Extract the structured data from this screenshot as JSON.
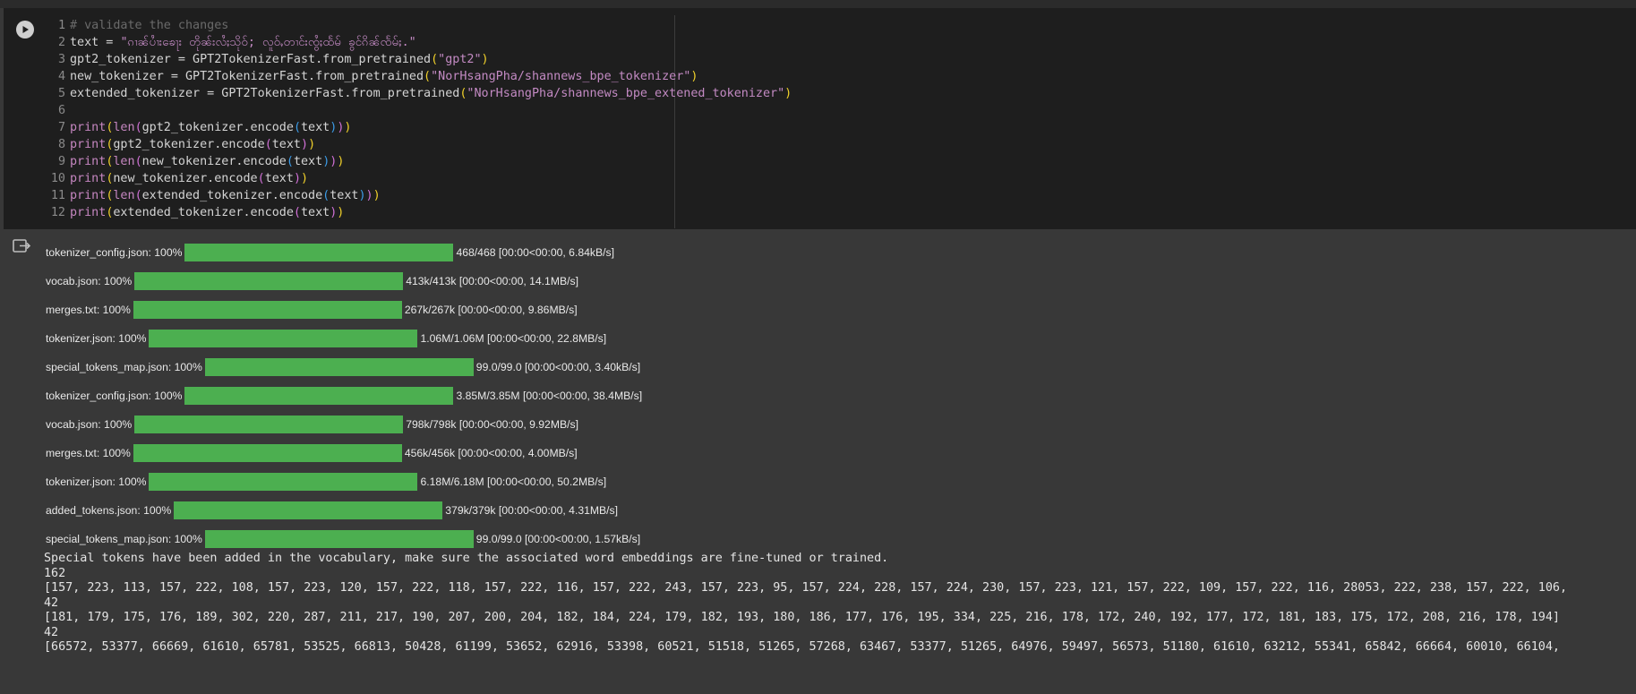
{
  "code_cell": {
    "lines": [
      {
        "n": "1",
        "tokens": [
          [
            "c-com",
            "# validate the changes"
          ]
        ]
      },
      {
        "n": "2",
        "tokens": [
          [
            "c-kw",
            "text = "
          ],
          [
            "c-str",
            "\"ၵၢၼ်ပၢႆးၶေႃး တိုၼ်းလႆႈသိုဝ်; လူဝ်ႇတၢင်းၸွႆႈထႅမ် ၶွင်ၵိၼ်ၸႅမ်ႈ.\""
          ]
        ]
      },
      {
        "n": "3",
        "tokens": [
          [
            "c-kw",
            "gpt2_tokenizer = GPT2TokenizerFast.from_pretrained"
          ],
          [
            "c-b1",
            "("
          ],
          [
            "c-str",
            "\"gpt2\""
          ],
          [
            "c-b1",
            ")"
          ]
        ]
      },
      {
        "n": "4",
        "tokens": [
          [
            "c-kw",
            "new_tokenizer = GPT2TokenizerFast.from_pretrained"
          ],
          [
            "c-b1",
            "("
          ],
          [
            "c-str",
            "\"NorHsangPha/shannews_bpe_tokenizer\""
          ],
          [
            "c-b1",
            ")"
          ]
        ]
      },
      {
        "n": "5",
        "tokens": [
          [
            "c-kw",
            "extended_tokenizer = GPT2TokenizerFast.from_pretrained"
          ],
          [
            "c-b1",
            "("
          ],
          [
            "c-str",
            "\"NorHsangPha/shannews_bpe_extened_tokenizer\""
          ],
          [
            "c-b1",
            ")"
          ]
        ]
      },
      {
        "n": "6",
        "tokens": []
      },
      {
        "n": "7",
        "tokens": [
          [
            "c-fn",
            "print"
          ],
          [
            "c-b1",
            "("
          ],
          [
            "c-fn",
            "len"
          ],
          [
            "c-b2",
            "("
          ],
          [
            "c-kw",
            "gpt2_tokenizer.encode"
          ],
          [
            "c-b3",
            "("
          ],
          [
            "c-kw",
            "text"
          ],
          [
            "c-b3",
            ")"
          ],
          [
            "c-b2",
            ")"
          ],
          [
            "c-b1",
            ")"
          ]
        ]
      },
      {
        "n": "8",
        "tokens": [
          [
            "c-fn",
            "print"
          ],
          [
            "c-b1",
            "("
          ],
          [
            "c-kw",
            "gpt2_tokenizer.encode"
          ],
          [
            "c-b2",
            "("
          ],
          [
            "c-kw",
            "text"
          ],
          [
            "c-b2",
            ")"
          ],
          [
            "c-b1",
            ")"
          ]
        ]
      },
      {
        "n": "9",
        "tokens": [
          [
            "c-fn",
            "print"
          ],
          [
            "c-b1",
            "("
          ],
          [
            "c-fn",
            "len"
          ],
          [
            "c-b2",
            "("
          ],
          [
            "c-kw",
            "new_tokenizer.encode"
          ],
          [
            "c-b3",
            "("
          ],
          [
            "c-kw",
            "text"
          ],
          [
            "c-b3",
            ")"
          ],
          [
            "c-b2",
            ")"
          ],
          [
            "c-b1",
            ")"
          ]
        ]
      },
      {
        "n": "10",
        "tokens": [
          [
            "c-fn",
            "print"
          ],
          [
            "c-b1",
            "("
          ],
          [
            "c-kw",
            "new_tokenizer.encode"
          ],
          [
            "c-b2",
            "("
          ],
          [
            "c-kw",
            "text"
          ],
          [
            "c-b2",
            ")"
          ],
          [
            "c-b1",
            ")"
          ]
        ]
      },
      {
        "n": "11",
        "tokens": [
          [
            "c-fn",
            "print"
          ],
          [
            "c-b1",
            "("
          ],
          [
            "c-fn",
            "len"
          ],
          [
            "c-b2",
            "("
          ],
          [
            "c-kw",
            "extended_tokenizer.encode"
          ],
          [
            "c-b3",
            "("
          ],
          [
            "c-kw",
            "text"
          ],
          [
            "c-b3",
            ")"
          ],
          [
            "c-b2",
            ")"
          ],
          [
            "c-b1",
            ")"
          ]
        ]
      },
      {
        "n": "12",
        "tokens": [
          [
            "c-fn",
            "print"
          ],
          [
            "c-b1",
            "("
          ],
          [
            "c-kw",
            "extended_tokenizer.encode"
          ],
          [
            "c-b2",
            "("
          ],
          [
            "c-kw",
            "text"
          ],
          [
            "c-b2",
            ")"
          ],
          [
            "c-b1",
            ")"
          ]
        ]
      }
    ]
  },
  "output": {
    "progress": [
      {
        "label": "tokenizer_config.json: 100%",
        "fill": 1.0,
        "stats": "468/468 [00:00<00:00, 6.84kB/s]"
      },
      {
        "label": "vocab.json: 100%",
        "fill": 1.0,
        "stats": "413k/413k [00:00<00:00, 14.1MB/s]"
      },
      {
        "label": "merges.txt: 100%",
        "fill": 1.0,
        "stats": "267k/267k [00:00<00:00, 9.86MB/s]"
      },
      {
        "label": "tokenizer.json: 100%",
        "fill": 1.0,
        "stats": "1.06M/1.06M [00:00<00:00, 22.8MB/s]"
      },
      {
        "label": "special_tokens_map.json: 100%",
        "fill": 1.0,
        "stats": "99.0/99.0 [00:00<00:00, 3.40kB/s]"
      },
      {
        "label": "tokenizer_config.json: 100%",
        "fill": 1.0,
        "stats": "3.85M/3.85M [00:00<00:00, 38.4MB/s]"
      },
      {
        "label": "vocab.json: 100%",
        "fill": 1.0,
        "stats": "798k/798k [00:00<00:00, 9.92MB/s]"
      },
      {
        "label": "merges.txt: 100%",
        "fill": 1.0,
        "stats": "456k/456k [00:00<00:00, 4.00MB/s]"
      },
      {
        "label": "tokenizer.json: 100%",
        "fill": 1.0,
        "stats": "6.18M/6.18M [00:00<00:00, 50.2MB/s]"
      },
      {
        "label": "added_tokens.json: 100%",
        "fill": 1.0,
        "stats": "379k/379k [00:00<00:00, 4.31MB/s]"
      },
      {
        "label": "special_tokens_map.json: 100%",
        "fill": 1.0,
        "stats": "99.0/99.0 [00:00<00:00, 1.57kB/s]"
      }
    ],
    "console": [
      "Special tokens have been added in the vocabulary, make sure the associated word embeddings are fine-tuned or trained.",
      "162",
      "[157, 223, 113, 157, 222, 108, 157, 223, 120, 157, 222, 118, 157, 222, 116, 157, 222, 243, 157, 223, 95, 157, 224, 228, 157, 224, 230, 157, 223, 121, 157, 222, 109, 157, 222, 116, 28053, 222, 238, 157, 222, 106,",
      "42",
      "[181, 179, 175, 176, 189, 302, 220, 287, 211, 217, 190, 207, 200, 204, 182, 184, 224, 179, 182, 193, 180, 186, 177, 176, 195, 334, 225, 216, 178, 172, 240, 192, 177, 172, 181, 183, 175, 172, 208, 216, 178, 194]",
      "42",
      "[66572, 53377, 66669, 61610, 65781, 53525, 66813, 50428, 61199, 53652, 62916, 53398, 60521, 51518, 51265, 57268, 63467, 53377, 51265, 64976, 59497, 56573, 51180, 61610, 63212, 55341, 65842, 66664, 60010, 66104,"
    ]
  }
}
